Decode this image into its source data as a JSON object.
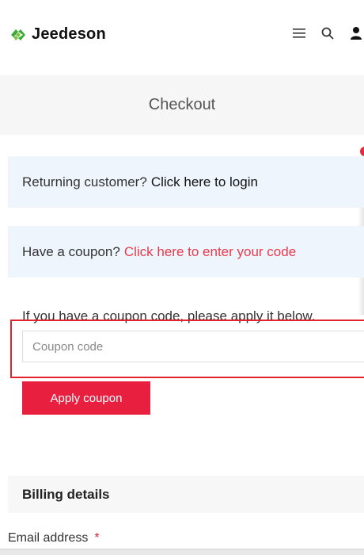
{
  "header": {
    "brand": "Jeedeson",
    "icons": [
      "menu-icon",
      "search-icon",
      "user-icon"
    ],
    "brand_color": "#3aaa35"
  },
  "page": {
    "title": "Checkout"
  },
  "notices": {
    "returning_prefix": "Returning customer?",
    "returning_link": "Click here to login",
    "coupon_prefix": "Have a coupon?",
    "coupon_link": "Click here to enter your code"
  },
  "coupon": {
    "instruction": "If you have a coupon code, please apply it below.",
    "placeholder": "Coupon code",
    "value": "",
    "button_label": "Apply coupon"
  },
  "billing": {
    "title": "Billing details",
    "email_label": "Email address",
    "required_mark": "*"
  },
  "colors": {
    "accent_red": "#e81f3e",
    "notice_bg": "#eef5fc",
    "link_red": "#e83b4b"
  }
}
